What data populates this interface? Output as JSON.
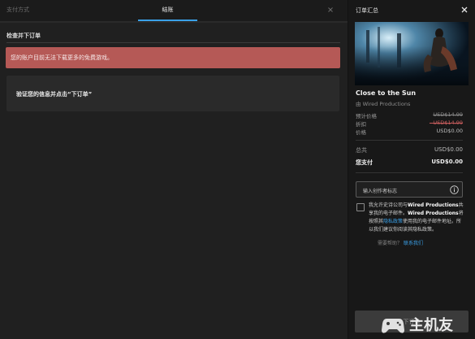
{
  "tabs": {
    "account": "支付方式",
    "checkout": "结账"
  },
  "main": {
    "section_title": "检查并下订单",
    "alert": "您的账户目前无法下载更多的免费游戏。",
    "confirm": "验证您的信息并点击“下订单”"
  },
  "summary": {
    "title": "订单汇总",
    "game_title": "Close to the Sun",
    "publisher": "由 Wired Productions",
    "rows": [
      {
        "label": "预计价格",
        "value": "USD$14.99",
        "style": "strike"
      },
      {
        "label": "折扣",
        "value": "- USD$14.99",
        "style": "red"
      },
      {
        "label": "价格",
        "value": "USD$0.00",
        "style": "normal"
      }
    ],
    "total_label": "总共",
    "total_value": "USD$0.00",
    "due_label": "您支付",
    "due_value": "USD$0.00"
  },
  "creator_code": {
    "placeholder": "输入创作者标志"
  },
  "consent": {
    "t1": "我允许史诗公司与",
    "publisher_bold": "Wired Productions",
    "t2": "共享我的电子邮件。",
    "publisher_bold2": "Wired Productions",
    "t3": "将按照其",
    "link": "隐私政策",
    "t4": "使用我的电子邮件地址。所以我们建议你阅读其隐私政策。"
  },
  "help": {
    "text": "需要帮助？",
    "link": "联系我们"
  },
  "order_button": "下订单",
  "watermark": {
    "text": "主机友"
  },
  "colors": {
    "accent": "#3aa0e8",
    "alert_bg": "#b55956",
    "panel_bg": "#202020",
    "summary_bg": "#181818"
  },
  "icons": {
    "tab_close": "x-icon",
    "summary_close": "close-icon",
    "info": "info-circle-icon",
    "watermark_logo": "gamepad-logo-icon"
  }
}
